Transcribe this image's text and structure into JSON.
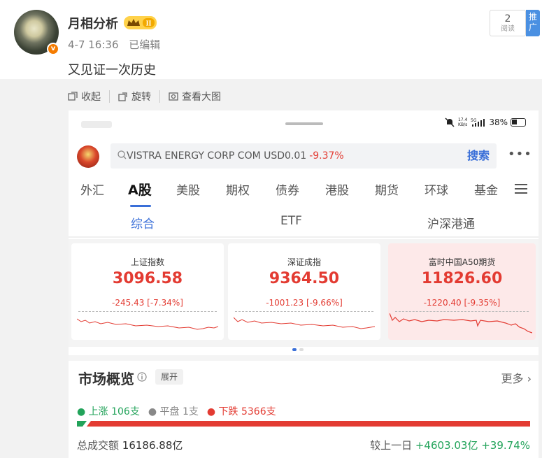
{
  "post": {
    "username": "月相分析",
    "vip_level": "II",
    "time": "4-7 16:36",
    "edited": "已编辑",
    "text": "又见证一次历史",
    "reads": "2",
    "reads_label": "阅读",
    "promo": "推广"
  },
  "toolbar": {
    "collect": "收起",
    "rotate": "旋转",
    "view_large": "查看大图"
  },
  "status_bar": {
    "speed_top": "17.4",
    "speed_unit": "KB/s",
    "network": "5G",
    "battery": "38%"
  },
  "search": {
    "text": "VISTRA ENERGY CORP COM USD0.01",
    "change": "-9.37%",
    "button": "搜索"
  },
  "tabs": [
    "外汇",
    "A股",
    "美股",
    "期权",
    "债券",
    "港股",
    "期货",
    "环球",
    "基金"
  ],
  "active_tab": "A股",
  "subtabs": [
    "综合",
    "ETF",
    "沪深港通"
  ],
  "cards": [
    {
      "title": "上证指数",
      "value": "3096.58",
      "change": "-245.43 [-7.34%]"
    },
    {
      "title": "深证成指",
      "value": "9364.50",
      "change": "-1001.23 [-9.66%]"
    },
    {
      "title": "富时中国A50期货",
      "value": "11826.60",
      "change": "-1220.40 [-9.35%]"
    }
  ],
  "overview": {
    "title": "市场概览",
    "expand": "展开",
    "more": "更多",
    "up": "上涨 106支",
    "flat": "平盘 1支",
    "down": "下跌 5366支",
    "up_count": 106,
    "flat_count": 1,
    "down_count": 5366,
    "turnover_label": "总成交额",
    "turnover_value": "16186.88亿",
    "vs_label": "较上一日",
    "vs_value": "+4603.03亿 +39.74%"
  },
  "colors": {
    "red": "#e33b32",
    "green": "#22a35a",
    "blue": "#3a6fd8"
  }
}
